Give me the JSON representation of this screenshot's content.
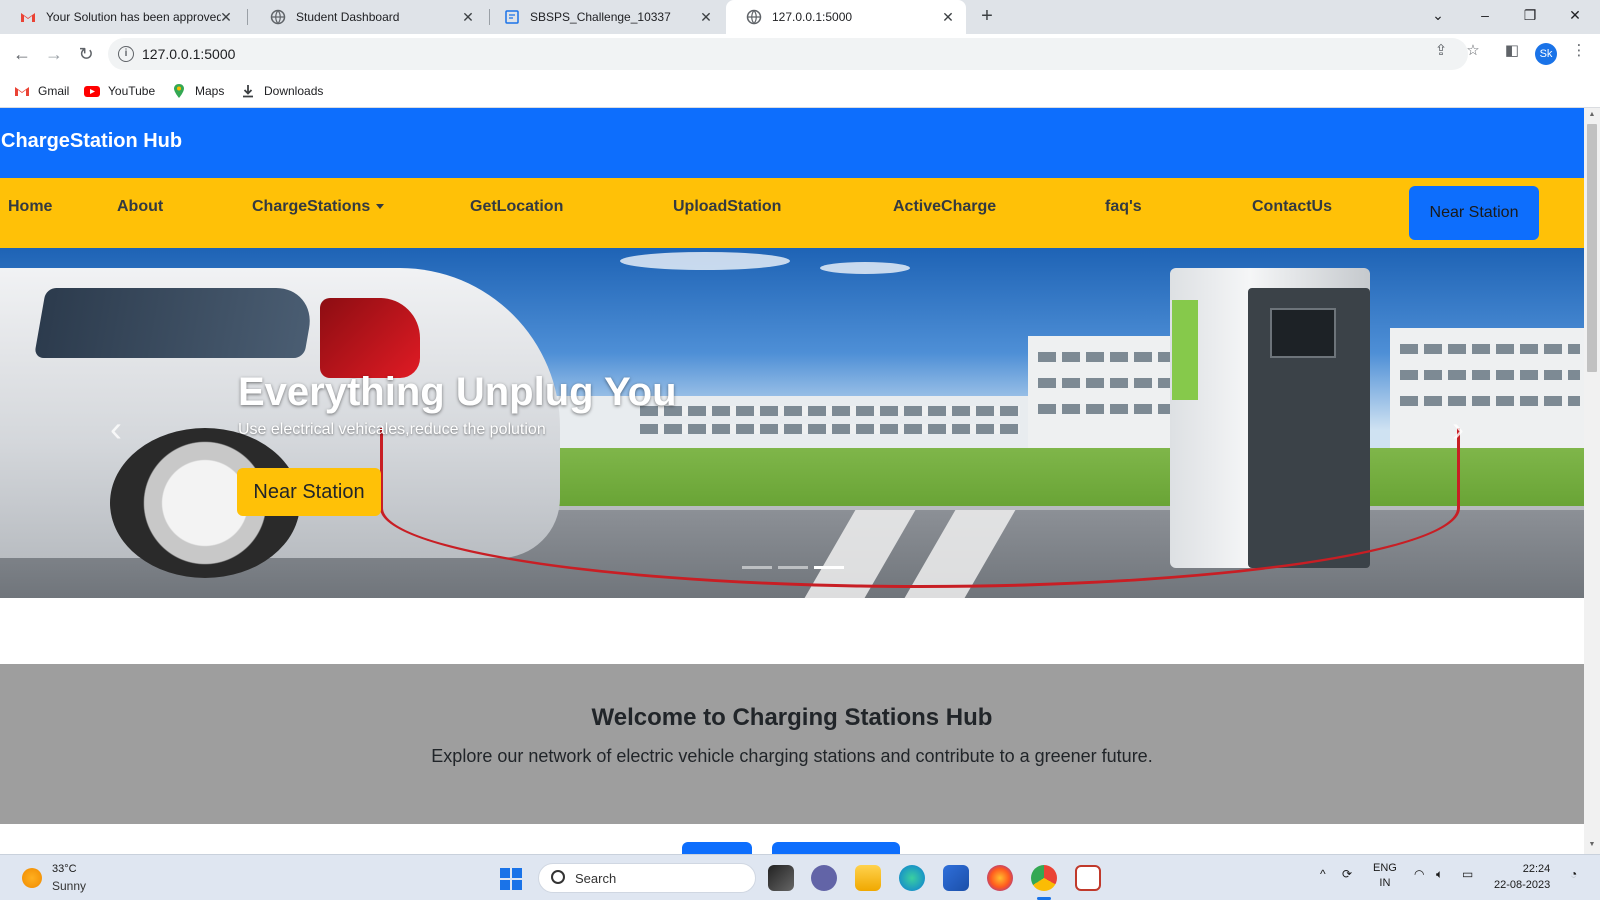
{
  "browser": {
    "tabs": [
      {
        "title": "Your Solution has been approved",
        "icon": "gmail-icon"
      },
      {
        "title": "Student Dashboard",
        "icon": "globe-icon"
      },
      {
        "title": "SBSPS_Challenge_10337",
        "icon": "document-icon"
      },
      {
        "title": "127.0.0.1:5000",
        "icon": "globe-icon",
        "active": true
      }
    ],
    "url": "127.0.0.1:5000",
    "profile_initials": "Sk",
    "bookmarks": [
      {
        "label": "Gmail",
        "icon": "gmail-icon"
      },
      {
        "label": "YouTube",
        "icon": "youtube-icon"
      },
      {
        "label": "Maps",
        "icon": "maps-pin-icon"
      },
      {
        "label": "Downloads",
        "icon": "download-icon"
      }
    ]
  },
  "site": {
    "brand": "ChargeStation Hub",
    "nav": {
      "items": [
        "Home",
        "About",
        "ChargeStations",
        "GetLocation",
        "UploadStation",
        "ActiveCharge",
        "faq's",
        "ContactUs"
      ],
      "cta": "Near Station"
    },
    "hero": {
      "title": "Everything Unplug You",
      "subtitle": "Use electrical vehicales,reduce the polution",
      "button": "Near Station"
    },
    "welcome": {
      "title": "Welcome to Charging Stations Hub",
      "text": "Explore our network of electric vehicle charging stations and contribute to a greener future."
    }
  },
  "colors": {
    "brand_blue": "#0d6efd",
    "nav_yellow": "#ffc107",
    "welcome_gray": "#9e9e9e"
  },
  "taskbar": {
    "weather": {
      "temp": "33°C",
      "condition": "Sunny"
    },
    "search_label": "Search",
    "lang": {
      "line1": "ENG",
      "line2": "IN"
    },
    "time": "22:24",
    "date": "22-08-2023"
  }
}
